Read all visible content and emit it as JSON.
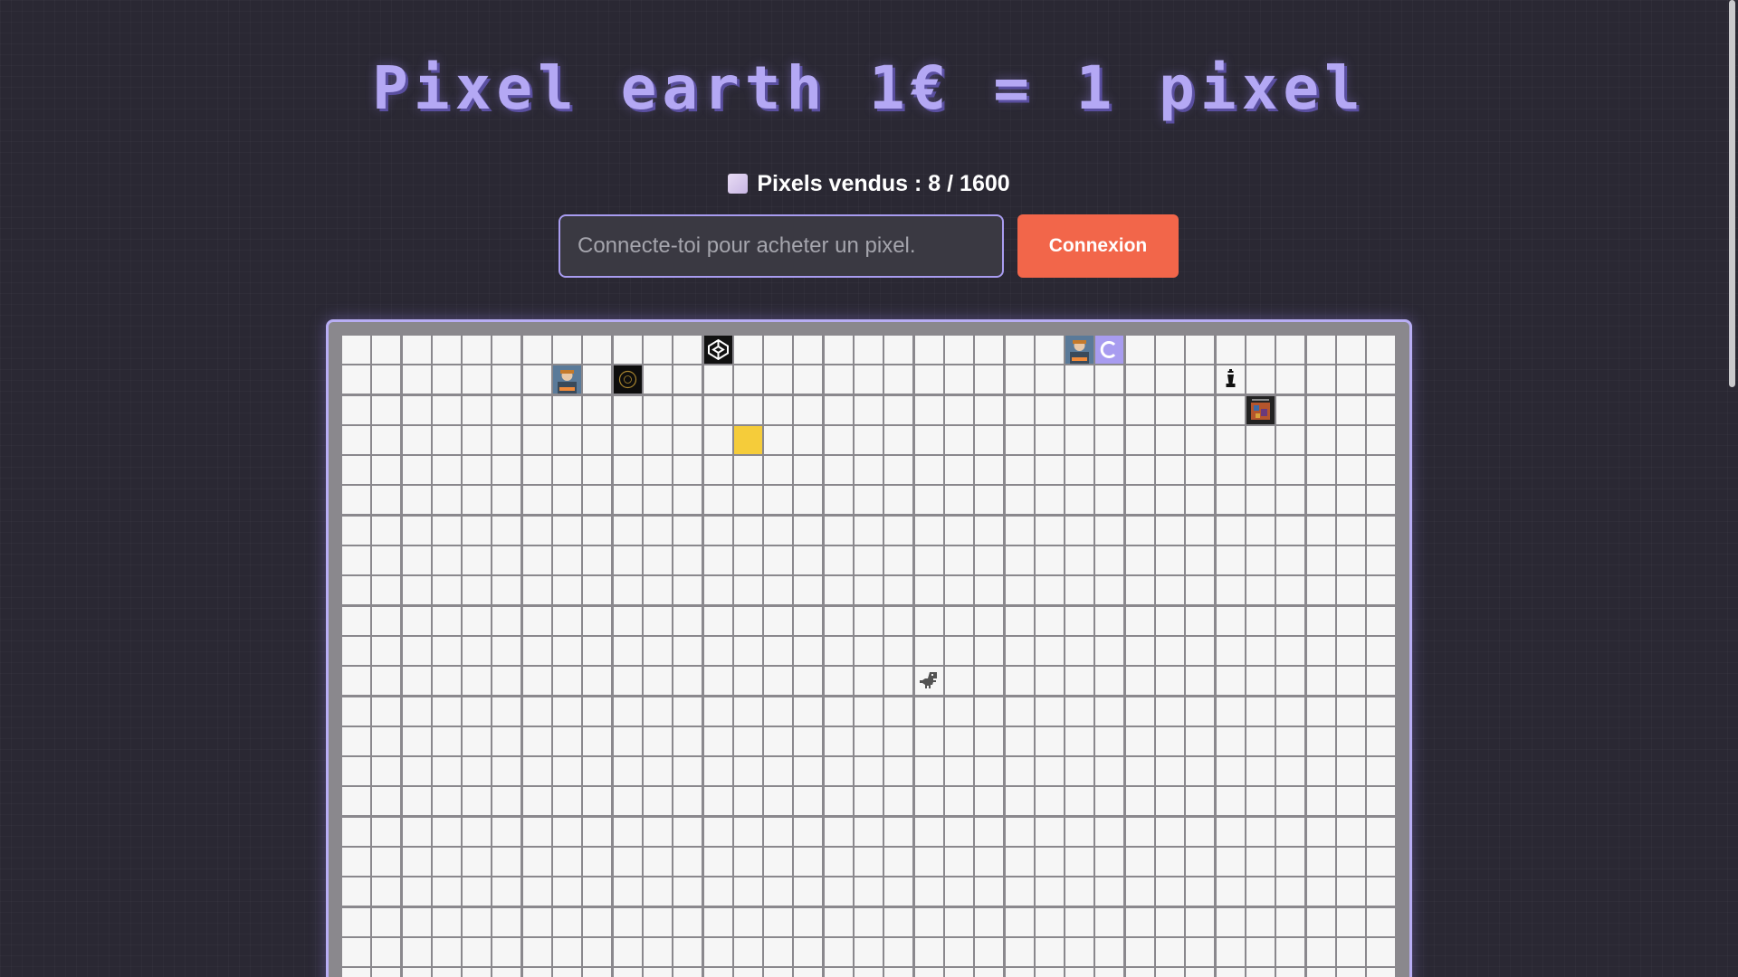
{
  "header": {
    "title": "Pixel earth 1€ = 1 pixel"
  },
  "stats": {
    "label": "Pixels vendus : 8 / 1600",
    "sold": 8,
    "total": 1600
  },
  "purchase": {
    "input_value": "",
    "input_placeholder": "Connecte-toi pour acheter un pixel.",
    "login_button": "Connexion"
  },
  "board": {
    "columns": 35,
    "pixels": [
      {
        "row": 0,
        "col": 12,
        "type": "codepen-logo-icon",
        "bg": "#111111"
      },
      {
        "row": 0,
        "col": 24,
        "type": "avatar-photo",
        "bg": "#6a8a9a"
      },
      {
        "row": 0,
        "col": 25,
        "type": "c-logo-icon",
        "bg": "#a89cf0"
      },
      {
        "row": 1,
        "col": 7,
        "type": "avatar-photo",
        "bg": "#4a6d9a"
      },
      {
        "row": 1,
        "col": 9,
        "type": "circle-logo-icon",
        "bg": "#0d0d0d"
      },
      {
        "row": 1,
        "col": 29,
        "type": "chess-knight-icon",
        "bg": "#f6f6f6"
      },
      {
        "row": 2,
        "col": 30,
        "type": "artwork-image",
        "bg": "#222222"
      },
      {
        "row": 3,
        "col": 13,
        "type": "yellow-square",
        "bg": "#f5cc3a"
      },
      {
        "row": 11,
        "col": 19,
        "type": "dinosaur-icon",
        "bg": "#f6f6f6"
      }
    ]
  },
  "colors": {
    "background": "#2a2833",
    "accent": "#b4a8f4",
    "button": "#f2664a",
    "grid_line": "#8a888d",
    "cell": "#f6f6f6"
  }
}
